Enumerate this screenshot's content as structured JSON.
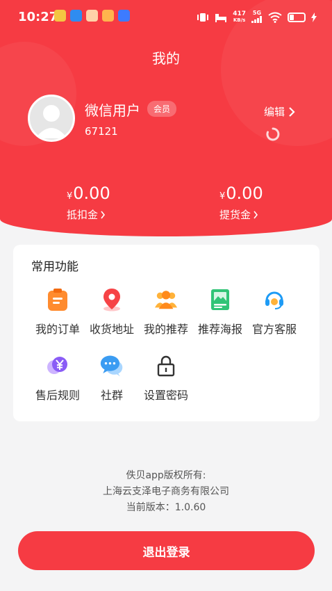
{
  "status_bar": {
    "time": "10:27",
    "net_speed": "417",
    "net_unit": "KB/s",
    "network": "5G"
  },
  "header": {
    "title": "我的"
  },
  "profile": {
    "nickname": "微信用户",
    "badge": "会员",
    "user_id": "67121",
    "edit_label": "编辑"
  },
  "balances": [
    {
      "currency": "¥",
      "amount": "0.00",
      "label": "抵扣金"
    },
    {
      "currency": "¥",
      "amount": "0.00",
      "label": "提货金"
    }
  ],
  "functions": {
    "title": "常用功能",
    "items": [
      {
        "label": "我的订单",
        "icon": "order-icon"
      },
      {
        "label": "收货地址",
        "icon": "location-pin-icon"
      },
      {
        "label": "我的推荐",
        "icon": "users-icon"
      },
      {
        "label": "推荐海报",
        "icon": "poster-icon"
      },
      {
        "label": "官方客服",
        "icon": "headset-icon"
      },
      {
        "label": "售后规则",
        "icon": "yen-coin-icon"
      },
      {
        "label": "社群",
        "icon": "chat-bubbles-icon"
      },
      {
        "label": "设置密码",
        "icon": "lock-icon"
      }
    ]
  },
  "footer": {
    "copyright_line1": "佚贝app版权所有:",
    "copyright_line2": "上海云支泽电子商务有限公司",
    "version": "当前版本：1.0.60"
  },
  "logout_label": "退出登录",
  "colors": {
    "primary": "#f63b43",
    "background": "#f4f4f5"
  }
}
